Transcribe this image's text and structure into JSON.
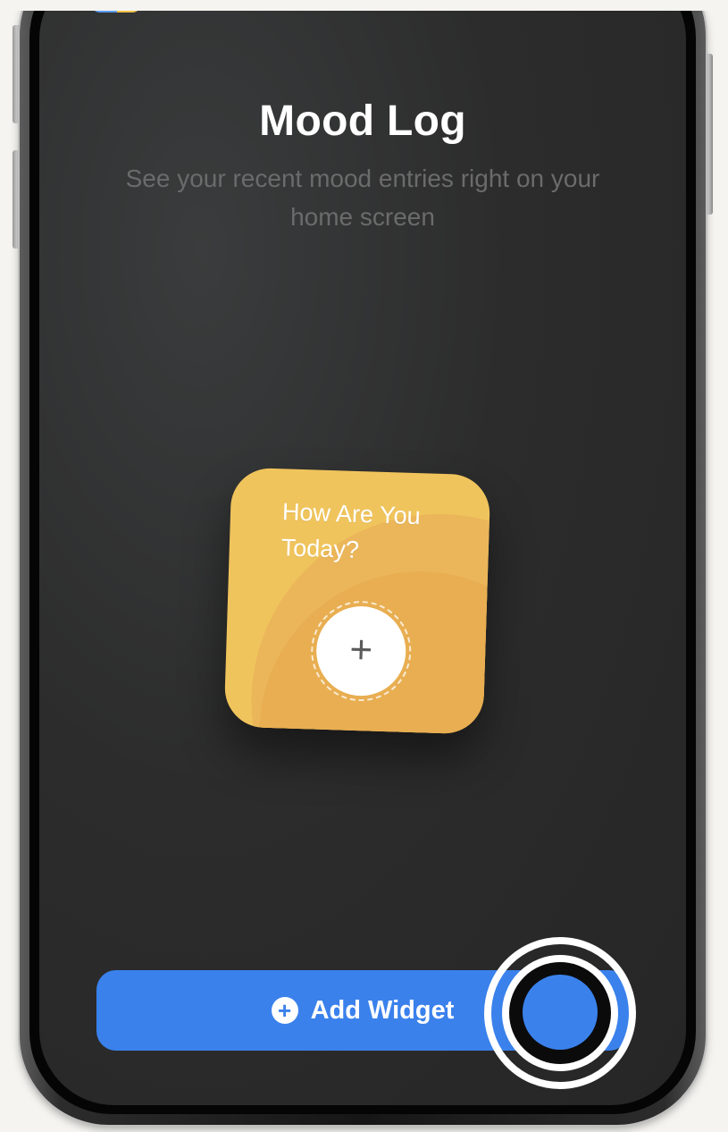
{
  "screen": {
    "title": "Mood Log",
    "subtitle": "See your recent mood entries right on your home screen"
  },
  "widget_preview": {
    "label": "How Are You Today?",
    "add_glyph": "+",
    "add_icon": "plus-icon"
  },
  "actions": {
    "add_widget_label": "Add Widget",
    "add_widget_icon": "plus-circle-icon"
  },
  "colors": {
    "accent": "#3a81ec",
    "widget_yellow": "#f0c45c",
    "screen_background": "#2c2c2c"
  }
}
